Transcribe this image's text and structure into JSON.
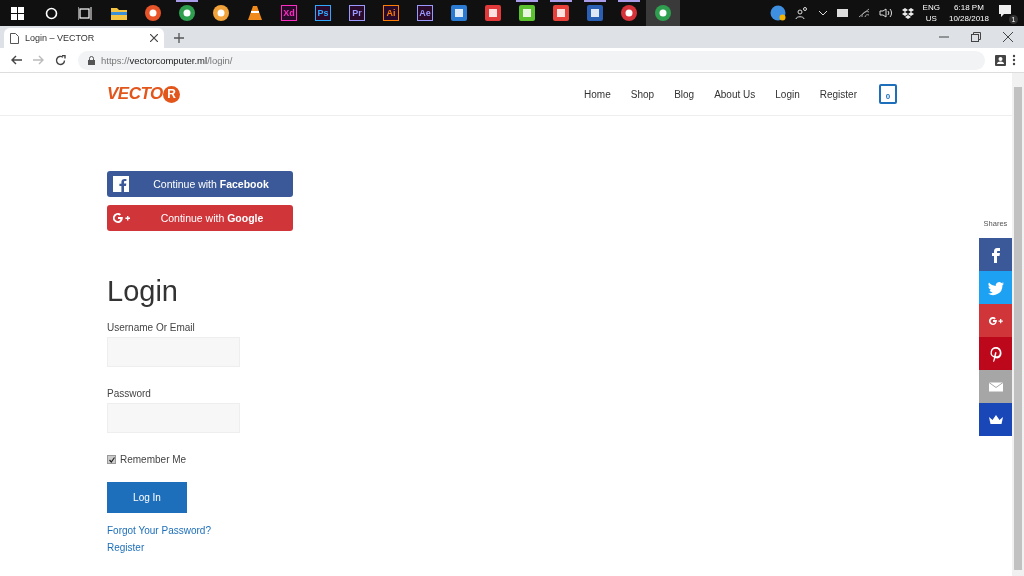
{
  "taskbar": {
    "apps": [
      {
        "kind": "folder",
        "color": "#f5c542",
        "running": false,
        "active": false
      },
      {
        "kind": "ball",
        "color": "#e8542a",
        "running": false,
        "active": false
      },
      {
        "kind": "ball",
        "color": "#2f9e4f",
        "running": true,
        "active": false
      },
      {
        "kind": "ball",
        "color": "#f2a23a",
        "running": false,
        "active": false
      },
      {
        "kind": "cone",
        "color": "#f08a1c",
        "running": false,
        "active": false
      },
      {
        "kind": "tile",
        "label": "Xd",
        "color": "#ff2bc2",
        "running": false,
        "active": false
      },
      {
        "kind": "tile",
        "label": "Ps",
        "color": "#31a8ff",
        "running": false,
        "active": false
      },
      {
        "kind": "tile",
        "label": "Pr",
        "color": "#9999ff",
        "running": false,
        "active": false
      },
      {
        "kind": "tile",
        "label": "Ai",
        "color": "#ff7c00",
        "running": false,
        "active": false
      },
      {
        "kind": "tile",
        "label": "Ae",
        "color": "#9999ff",
        "running": false,
        "active": false
      },
      {
        "kind": "square",
        "color": "#2b7bd3",
        "running": false,
        "active": false
      },
      {
        "kind": "square",
        "color": "#e23a3a",
        "running": false,
        "active": false
      },
      {
        "kind": "square",
        "color": "#5cc12f",
        "running": true,
        "active": false
      },
      {
        "kind": "square",
        "color": "#e8403a",
        "running": true,
        "active": false
      },
      {
        "kind": "square",
        "color": "#2b5fb4",
        "running": true,
        "active": false
      },
      {
        "kind": "ball",
        "color": "#d6323a",
        "running": true,
        "active": false
      },
      {
        "kind": "ball",
        "color": "#2f9e4f",
        "running": false,
        "active": true
      }
    ],
    "language": "ENG",
    "region": "US",
    "time": "6:18 PM",
    "date": "10/28/2018",
    "notifications": "1"
  },
  "browser": {
    "tab": {
      "title": "Login – VECTOR"
    },
    "url": {
      "scheme": "https://",
      "host": "vectorcomputer.ml",
      "path": "/login/"
    }
  },
  "site": {
    "logo": {
      "text": "VECTO",
      "badge": "R"
    },
    "nav": [
      {
        "label": "Home"
      },
      {
        "label": "Shop"
      },
      {
        "label": "Blog"
      },
      {
        "label": "About Us"
      },
      {
        "label": "Login"
      },
      {
        "label": "Register"
      }
    ],
    "cart_count": "0"
  },
  "social_login": [
    {
      "kind": "facebook",
      "text": "Continue with **Facebook**",
      "color": "#3b5998"
    },
    {
      "kind": "google",
      "text": "Continue with **Google**",
      "color": "#d0353a"
    }
  ],
  "login": {
    "heading": "Login",
    "fields": [
      {
        "label": "Username Or Email"
      },
      {
        "label": "Password"
      }
    ],
    "remember": {
      "label": "Remember Me",
      "checked": true
    },
    "submit": "Log In",
    "links": [
      "Forgot Your Password?",
      "Register"
    ]
  },
  "shares": {
    "title": "Shares",
    "buttons": [
      {
        "kind": "facebook",
        "color": "#3b5998"
      },
      {
        "kind": "twitter",
        "color": "#1da1f2"
      },
      {
        "kind": "googleplus",
        "color": "#d0353a"
      },
      {
        "kind": "pinterest",
        "color": "#bd081c"
      },
      {
        "kind": "email",
        "color": "#a6a6a6"
      },
      {
        "kind": "crown",
        "color": "#1a47b8"
      }
    ]
  }
}
